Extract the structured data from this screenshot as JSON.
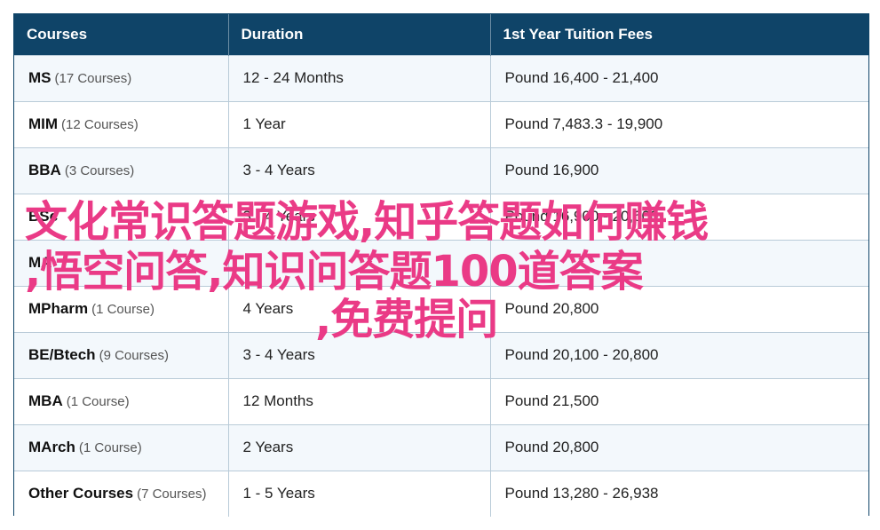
{
  "table": {
    "headers": [
      "Courses",
      "Duration",
      "1st Year Tuition Fees"
    ],
    "rows": [
      {
        "name": "MS",
        "count": "(17 Courses)",
        "duration": "12 - 24 Months",
        "fees": "Pound 16,400 - 21,400"
      },
      {
        "name": "MIM",
        "count": "(12 Courses)",
        "duration": "1 Year",
        "fees": "Pound 7,483.3 - 19,900"
      },
      {
        "name": "BBA",
        "count": "(3 Courses)",
        "duration": "3 - 4 Years",
        "fees": "Pound 16,900"
      },
      {
        "name": "BSc",
        "count": "",
        "duration": "3 - 4 Years",
        "fees": "Pound 16,900 - 20,600"
      },
      {
        "name": "MA",
        "count": "",
        "duration": "",
        "fees": ""
      },
      {
        "name": "MPharm",
        "count": "(1 Course)",
        "duration": "4 Years",
        "fees": "Pound 20,800"
      },
      {
        "name": "BE/Btech",
        "count": "(9 Courses)",
        "duration": "3 - 4 Years",
        "fees": "Pound 20,100 - 20,800"
      },
      {
        "name": "MBA",
        "count": "(1 Course)",
        "duration": "12 Months",
        "fees": "Pound 21,500"
      },
      {
        "name": "MArch",
        "count": "(1 Course)",
        "duration": "2 Years",
        "fees": "Pound 20,800"
      },
      {
        "name": "Other Courses",
        "count": "(7 Courses)",
        "duration": "1 - 5 Years",
        "fees": "Pound 13,280 - 26,938"
      }
    ]
  },
  "overlay": {
    "line1": "文化常识答题游戏,知乎答题如何赚钱",
    "line2": ",悟空问答,知识问答题100道答案",
    "line3": ",免费提问"
  },
  "colors": {
    "header_bg": "#0f4468",
    "overlay_text": "#ea3a86",
    "row_alt": "#f3f8fc"
  }
}
